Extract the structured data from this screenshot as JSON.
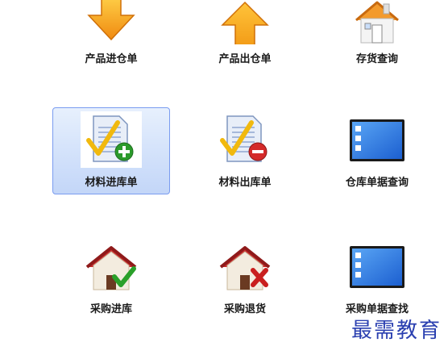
{
  "tiles": [
    {
      "label": "产品进仓单",
      "icon": "arrow-down-icon"
    },
    {
      "label": "产品出仓单",
      "icon": "arrow-up-icon"
    },
    {
      "label": "存货查询",
      "icon": "house-icon"
    },
    {
      "label": "材料进库单",
      "icon": "document-check-add-icon",
      "selected": true
    },
    {
      "label": "材料出库单",
      "icon": "document-check-remove-icon"
    },
    {
      "label": "仓库单据查询",
      "icon": "window-icon"
    },
    {
      "label": "采购进库",
      "icon": "house-check-icon"
    },
    {
      "label": "采购退货",
      "icon": "house-x-icon"
    },
    {
      "label": "采购单据查找",
      "icon": "window-icon"
    }
  ],
  "watermark": "最需教育",
  "colors": {
    "selection_border": "#7a9cf0",
    "watermark": "#2a3fb0",
    "orange": "#f7a21b"
  }
}
